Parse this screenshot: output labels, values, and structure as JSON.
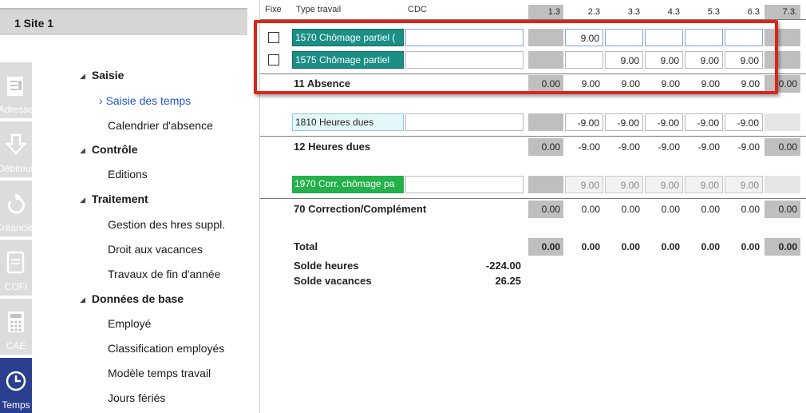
{
  "site": {
    "title": "1 Site 1"
  },
  "rail": [
    {
      "label": "Adresse",
      "icon": "address-icon"
    },
    {
      "label": "Débiteur",
      "icon": "debtor-icon"
    },
    {
      "label": "Créancier",
      "icon": "creditor-icon"
    },
    {
      "label": "COFI",
      "icon": "document-icon"
    },
    {
      "label": "CAE",
      "icon": "calculator-icon"
    },
    {
      "label": "Temps",
      "icon": "clock-icon"
    }
  ],
  "nav": {
    "saisie": "Saisie",
    "saisie_temps": "Saisie des temps",
    "calendrier": "Calendrier d'absence",
    "controle": "Contrôle",
    "editions": "Editions",
    "traitement": "Traitement",
    "gestion_hres": "Gestion des hres suppl.",
    "droit_vacances": "Droit aux vacances",
    "travaux": "Travaux de fin d'année",
    "donnees": "Données de base",
    "employe": "Employé",
    "classification": "Classification employés",
    "modele": "Modèle temps travail",
    "jours": "Jours fériés"
  },
  "grid": {
    "headers": {
      "fixe": "Fixe",
      "type": "Type travail",
      "cdc": "CDC"
    },
    "columns": [
      "1.3",
      "2.3",
      "3.3",
      "4.3",
      "5.3",
      "6.3",
      "7.3."
    ],
    "rows": {
      "r1570": {
        "label": "1570 Chômage partiel (",
        "v1": "9.00"
      },
      "r1575": {
        "label": "1575 Chômage partiel",
        "v": "9.00"
      },
      "absence": {
        "label": "11 Absence",
        "first": "0.00",
        "v": "9.00",
        "last": "0.00"
      },
      "r1810": {
        "label": "1810 Heures dues",
        "v": "-9.00"
      },
      "heures_dues": {
        "label": "12 Heures dues",
        "first": "0.00",
        "v": "-9.00",
        "last": "0.00"
      },
      "r1970": {
        "label": "1970 Corr. chômage pa",
        "v": "9.00"
      },
      "correction": {
        "label": "70 Correction/Complément",
        "v": "0.00"
      },
      "total": {
        "label": "Total",
        "v": "0.00"
      }
    },
    "solde_heures": {
      "label": "Solde heures",
      "value": "-224.00"
    },
    "solde_vacances": {
      "label": "Solde vacances",
      "value": "26.25"
    }
  }
}
